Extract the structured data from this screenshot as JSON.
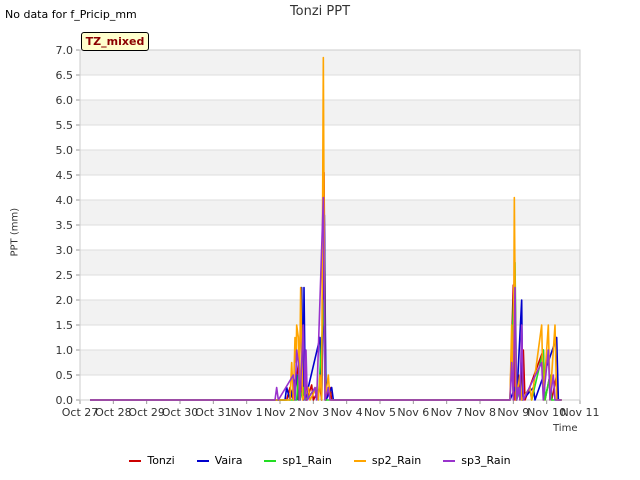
{
  "header": {
    "no_data": "No data for f_Pricip_mm",
    "title": "Tonzi PPT",
    "badge": "TZ_mixed"
  },
  "chart_data": {
    "type": "line",
    "title": "Tonzi PPT",
    "xlabel": "Time",
    "ylabel": "PPT (mm)",
    "xlim": [
      0,
      15
    ],
    "ylim": [
      0,
      7.0
    ],
    "x_ticks": [
      {
        "x": 0,
        "label": "Oct 27"
      },
      {
        "x": 1,
        "label": "Oct 28"
      },
      {
        "x": 2,
        "label": "Oct 29"
      },
      {
        "x": 3,
        "label": "Oct 30"
      },
      {
        "x": 4,
        "label": "Oct 31"
      },
      {
        "x": 5,
        "label": "Nov 1"
      },
      {
        "x": 6,
        "label": "Nov 2"
      },
      {
        "x": 7,
        "label": "Nov 3"
      },
      {
        "x": 8,
        "label": "Nov 4"
      },
      {
        "x": 9,
        "label": "Nov 5"
      },
      {
        "x": 10,
        "label": "Nov 6"
      },
      {
        "x": 11,
        "label": "Nov 7"
      },
      {
        "x": 12,
        "label": "Nov 8"
      },
      {
        "x": 13,
        "label": "Nov 9"
      },
      {
        "x": 14,
        "label": "Nov 10"
      },
      {
        "x": 15,
        "label": "Nov 11"
      }
    ],
    "y_ticks": [
      "0.0",
      "0.5",
      "1.0",
      "1.5",
      "2.0",
      "2.5",
      "3.0",
      "3.5",
      "4.0",
      "4.5",
      "5.0",
      "5.5",
      "6.0",
      "6.5",
      "7.0"
    ],
    "series": [
      {
        "name": "Tonzi",
        "color": "#cc0000",
        "data": [
          [
            0.3,
            0
          ],
          [
            6.2,
            0
          ],
          [
            6.3,
            0.25
          ],
          [
            6.4,
            0
          ],
          [
            6.55,
            0.7
          ],
          [
            6.6,
            0
          ],
          [
            6.75,
            1.0
          ],
          [
            6.8,
            0
          ],
          [
            6.95,
            0.3
          ],
          [
            7.0,
            0
          ],
          [
            7.2,
            0.25
          ],
          [
            7.25,
            0
          ],
          [
            7.32,
            4.55
          ],
          [
            7.37,
            0
          ],
          [
            7.5,
            0.25
          ],
          [
            7.55,
            0
          ],
          [
            7.65,
            0
          ],
          [
            12.9,
            0
          ],
          [
            13.0,
            2.3
          ],
          [
            13.05,
            0
          ],
          [
            13.15,
            0.5
          ],
          [
            13.2,
            0
          ],
          [
            13.3,
            1.0
          ],
          [
            13.35,
            0
          ],
          [
            13.9,
            1.0
          ],
          [
            13.95,
            0
          ],
          [
            14.1,
            0.5
          ],
          [
            14.15,
            0
          ],
          [
            14.3,
            0.5
          ],
          [
            14.35,
            0
          ],
          [
            14.45,
            0
          ]
        ]
      },
      {
        "name": "Vaira",
        "color": "#0000cc",
        "data": [
          [
            0.3,
            0
          ],
          [
            6.15,
            0
          ],
          [
            6.2,
            0.25
          ],
          [
            6.3,
            0
          ],
          [
            6.5,
            0.5
          ],
          [
            6.55,
            0
          ],
          [
            6.65,
            2.25
          ],
          [
            6.7,
            0
          ],
          [
            6.72,
            2.25
          ],
          [
            6.76,
            0
          ],
          [
            7.2,
            1.25
          ],
          [
            7.25,
            0
          ],
          [
            7.33,
            3.7
          ],
          [
            7.38,
            0
          ],
          [
            7.55,
            0.25
          ],
          [
            7.6,
            0
          ],
          [
            7.65,
            0
          ],
          [
            12.9,
            0
          ],
          [
            13.05,
            0.25
          ],
          [
            13.1,
            0
          ],
          [
            13.25,
            2.0
          ],
          [
            13.28,
            0
          ],
          [
            13.6,
            0.25
          ],
          [
            13.65,
            0
          ],
          [
            14.3,
            1.25
          ],
          [
            14.35,
            0
          ],
          [
            14.45,
            0
          ]
        ]
      },
      {
        "name": "sp1_Rain",
        "color": "#22dd22",
        "data": [
          [
            0.3,
            0
          ],
          [
            6.5,
            0
          ],
          [
            6.55,
            0.5
          ],
          [
            6.6,
            0
          ],
          [
            6.7,
            0.25
          ],
          [
            6.75,
            0
          ],
          [
            7.1,
            0.25
          ],
          [
            7.15,
            0
          ],
          [
            7.32,
            2.0
          ],
          [
            7.36,
            0
          ],
          [
            7.65,
            0
          ],
          [
            12.9,
            0
          ],
          [
            13.05,
            2.75
          ],
          [
            13.1,
            0
          ],
          [
            13.2,
            0.25
          ],
          [
            13.25,
            0
          ],
          [
            13.5,
            0.25
          ],
          [
            13.55,
            0
          ],
          [
            13.9,
            1.0
          ],
          [
            13.95,
            0
          ],
          [
            14.1,
            0.5
          ],
          [
            14.15,
            0
          ],
          [
            14.45,
            0
          ]
        ]
      },
      {
        "name": "sp2_Rain",
        "color": "#ffa500",
        "data": [
          [
            0.3,
            0
          ],
          [
            6.3,
            0
          ],
          [
            6.35,
            0.75
          ],
          [
            6.4,
            0
          ],
          [
            6.45,
            1.25
          ],
          [
            6.48,
            0.75
          ],
          [
            6.5,
            1.5
          ],
          [
            6.55,
            1.25
          ],
          [
            6.58,
            0
          ],
          [
            6.62,
            2.25
          ],
          [
            6.68,
            0
          ],
          [
            6.85,
            0.25
          ],
          [
            6.9,
            0
          ],
          [
            7.1,
            0.25
          ],
          [
            7.15,
            0
          ],
          [
            7.2,
            0.5
          ],
          [
            7.25,
            0
          ],
          [
            7.3,
            6.85
          ],
          [
            7.35,
            0
          ],
          [
            7.45,
            0.5
          ],
          [
            7.5,
            0
          ],
          [
            7.65,
            0
          ],
          [
            12.9,
            0
          ],
          [
            12.95,
            1.5
          ],
          [
            13.0,
            0
          ],
          [
            13.03,
            4.05
          ],
          [
            13.08,
            0
          ],
          [
            13.2,
            0.5
          ],
          [
            13.25,
            0
          ],
          [
            13.5,
            0.25
          ],
          [
            13.55,
            0
          ],
          [
            13.85,
            1.5
          ],
          [
            13.9,
            0
          ],
          [
            14.05,
            1.5
          ],
          [
            14.1,
            0
          ],
          [
            14.25,
            1.5
          ],
          [
            14.3,
            0
          ],
          [
            14.45,
            0
          ]
        ]
      },
      {
        "name": "sp3_Rain",
        "color": "#9933cc",
        "data": [
          [
            0.3,
            0
          ],
          [
            5.85,
            0
          ],
          [
            5.9,
            0.25
          ],
          [
            5.95,
            0
          ],
          [
            6.4,
            0.5
          ],
          [
            6.45,
            0
          ],
          [
            6.5,
            1.0
          ],
          [
            6.55,
            0.75
          ],
          [
            6.6,
            0
          ],
          [
            6.7,
            1.5
          ],
          [
            6.75,
            0
          ],
          [
            6.78,
            1.0
          ],
          [
            6.82,
            0
          ],
          [
            7.05,
            0.25
          ],
          [
            7.1,
            0
          ],
          [
            7.3,
            4.05
          ],
          [
            7.35,
            0
          ],
          [
            7.45,
            0.25
          ],
          [
            7.5,
            0
          ],
          [
            7.65,
            0
          ],
          [
            12.9,
            0
          ],
          [
            12.95,
            0.75
          ],
          [
            13.0,
            0
          ],
          [
            13.05,
            2.25
          ],
          [
            13.1,
            0
          ],
          [
            13.15,
            0.25
          ],
          [
            13.2,
            0
          ],
          [
            13.25,
            1.5
          ],
          [
            13.3,
            0
          ],
          [
            13.85,
            0.75
          ],
          [
            13.9,
            0
          ],
          [
            14.05,
            1.0
          ],
          [
            14.1,
            0
          ],
          [
            14.2,
            0.5
          ],
          [
            14.25,
            0
          ],
          [
            14.45,
            0
          ]
        ]
      }
    ]
  }
}
